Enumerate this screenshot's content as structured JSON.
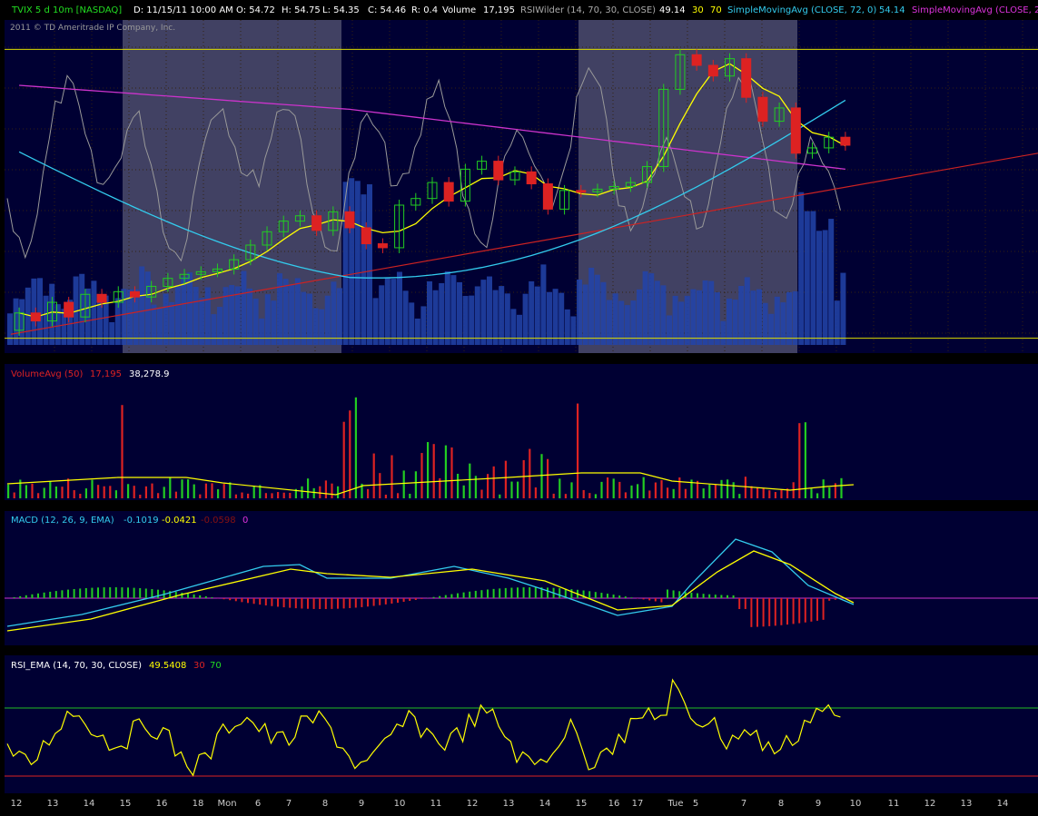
{
  "header": {
    "symbol": "TVIX 5 d 10m [NASDAQ]",
    "date": "D: 11/15/11 10:00 AM",
    "open": "O: 54.72",
    "high": "H: 54.75",
    "low": "L: 54.35",
    "close": "C: 54.46",
    "range": "R: 0.4",
    "volume_label": "Volume",
    "volume_value": "17,195",
    "rsi_label": "RSIWilder (14, 70, 30, CLOSE)",
    "rsi_value": "49.14",
    "rsi_low": "30",
    "rsi_high": "70",
    "sma1_label": "SimpleMovingAvg (CLOSE, 72, 0)",
    "sma1_value": "54.14",
    "sma2_label": "SimpleMovingAvg (CLOSE, 2"
  },
  "copyright": "2011 © TD Ameritrade IP Company, Inc.",
  "volume_panel": {
    "label": "VolumeAvg (50)",
    "value": "17,195",
    "avg": "38,278.9"
  },
  "macd_panel": {
    "label": "MACD (12, 26, 9, EMA)",
    "value": "-0.1019",
    "avg": "-0.0421",
    "diff": "-0.0598",
    "zero": "0"
  },
  "rsi_panel": {
    "label": "RSI_EMA (14, 70, 30, CLOSE)",
    "value": "49.5408",
    "low": "30",
    "high": "70"
  },
  "xaxis_labels": [
    "12",
    "13",
    "14",
    "15",
    "16",
    "18",
    "Mon",
    "6",
    "7",
    "8",
    "9",
    "10",
    "11",
    "12",
    "13",
    "14",
    "15",
    "16",
    "17",
    "Tue",
    "5",
    "7",
    "8",
    "9",
    "10",
    "11",
    "12",
    "13",
    "14"
  ],
  "colors": {
    "up": "#22cc22",
    "down": "#dd2222",
    "ma_yellow": "#ffff00",
    "ma_cyan": "#33ccee",
    "ma_magenta": "#cc33cc",
    "trend_red": "#cc2222",
    "bg": "#000033",
    "session": "#444466"
  },
  "chart_data": {
    "type": "candlestick",
    "symbol": "TVIX",
    "interval": "10m",
    "candles": [
      {
        "t": 0,
        "o": 44.1,
        "c": 45.4
      },
      {
        "t": 1,
        "o": 45.4,
        "c": 44.8
      },
      {
        "t": 2,
        "o": 44.8,
        "c": 46.2
      },
      {
        "t": 3,
        "o": 46.2,
        "c": 45.1
      },
      {
        "t": 4,
        "o": 45.1,
        "c": 46.8
      },
      {
        "t": 5,
        "o": 46.8,
        "c": 46.2
      },
      {
        "t": 6,
        "o": 46.2,
        "c": 47.0
      },
      {
        "t": 7,
        "o": 47.0,
        "c": 46.6
      },
      {
        "t": 8,
        "o": 46.6,
        "c": 47.4
      },
      {
        "t": 9,
        "o": 47.4,
        "c": 48.0
      },
      {
        "t": 10,
        "o": 48.0,
        "c": 48.3
      },
      {
        "t": 11,
        "o": 48.3,
        "c": 48.5
      },
      {
        "t": 12,
        "o": 48.5,
        "c": 48.7
      },
      {
        "t": 13,
        "o": 48.7,
        "c": 49.4
      },
      {
        "t": 14,
        "o": 49.4,
        "c": 50.5
      },
      {
        "t": 15,
        "o": 50.5,
        "c": 51.5
      },
      {
        "t": 16,
        "o": 51.5,
        "c": 52.3
      },
      {
        "t": 17,
        "o": 52.3,
        "c": 52.7
      },
      {
        "t": 18,
        "o": 52.7,
        "c": 51.6
      },
      {
        "t": 19,
        "o": 51.6,
        "c": 53.0
      },
      {
        "t": 20,
        "o": 53.0,
        "c": 51.8
      },
      {
        "t": 21,
        "o": 51.8,
        "c": 50.6
      },
      {
        "t": 22,
        "o": 50.6,
        "c": 50.3
      },
      {
        "t": 23,
        "o": 50.3,
        "c": 53.5
      },
      {
        "t": 24,
        "o": 53.5,
        "c": 54.0
      },
      {
        "t": 25,
        "o": 54.0,
        "c": 55.2
      },
      {
        "t": 26,
        "o": 55.2,
        "c": 53.8
      },
      {
        "t": 27,
        "o": 53.8,
        "c": 56.2
      },
      {
        "t": 28,
        "o": 56.2,
        "c": 56.8
      },
      {
        "t": 29,
        "o": 56.8,
        "c": 55.4
      },
      {
        "t": 30,
        "o": 55.4,
        "c": 56.0
      },
      {
        "t": 31,
        "o": 56.0,
        "c": 55.1
      },
      {
        "t": 32,
        "o": 55.1,
        "c": 53.2
      },
      {
        "t": 33,
        "o": 53.2,
        "c": 54.6
      },
      {
        "t": 34,
        "o": 54.6,
        "c": 54.5
      },
      {
        "t": 35,
        "o": 54.5,
        "c": 54.7
      },
      {
        "t": 36,
        "o": 54.7,
        "c": 54.9
      },
      {
        "t": 37,
        "o": 54.9,
        "c": 55.2
      },
      {
        "t": 38,
        "o": 55.2,
        "c": 56.4
      },
      {
        "t": 39,
        "o": 56.4,
        "c": 62.2
      },
      {
        "t": 40,
        "o": 62.2,
        "c": 64.8
      },
      {
        "t": 41,
        "o": 64.8,
        "c": 64.0
      },
      {
        "t": 42,
        "o": 64.0,
        "c": 63.2
      },
      {
        "t": 43,
        "o": 63.2,
        "c": 64.5
      },
      {
        "t": 44,
        "o": 64.5,
        "c": 61.6
      },
      {
        "t": 45,
        "o": 61.6,
        "c": 59.8
      },
      {
        "t": 46,
        "o": 59.8,
        "c": 60.8
      },
      {
        "t": 47,
        "o": 60.8,
        "c": 57.4
      },
      {
        "t": 48,
        "o": 57.4,
        "c": 57.8
      },
      {
        "t": 49,
        "o": 57.8,
        "c": 58.6
      },
      {
        "t": 50,
        "o": 58.6,
        "c": 58.0
      }
    ],
    "ylim": [
      43,
      67
    ],
    "overlays": [
      "SimpleMovingAvg (CLOSE, 72, 0)",
      "SimpleMovingAvg (CLOSE, 2",
      "RSIWilder (14, 70, 30, CLOSE)"
    ],
    "horizontal_lines": [
      65.2,
      43.5
    ]
  }
}
